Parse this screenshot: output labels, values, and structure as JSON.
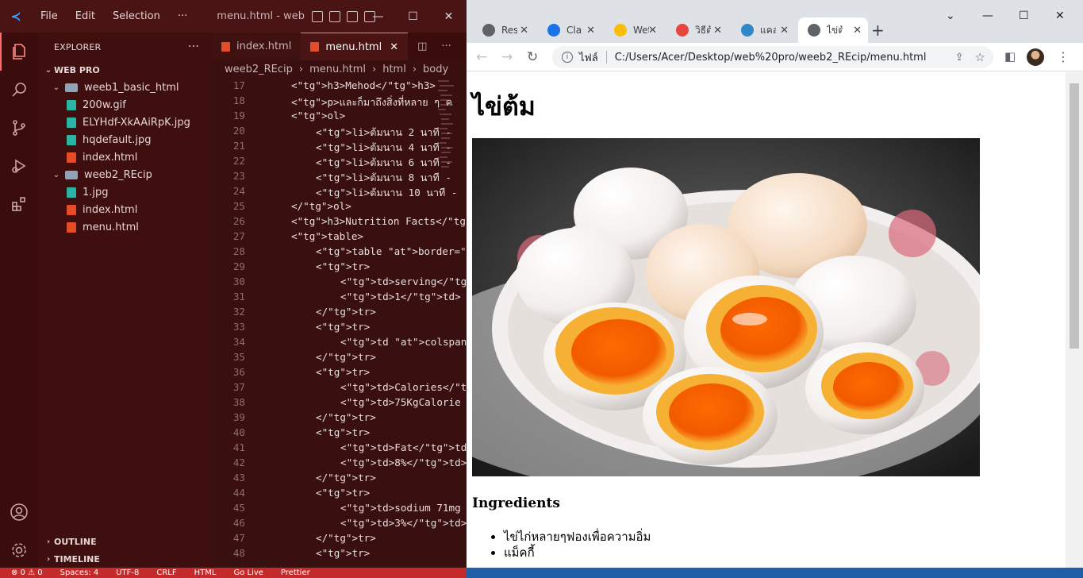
{
  "vscode": {
    "menu": [
      "File",
      "Edit",
      "Selection",
      "···"
    ],
    "window_title": "menu.html - web p...",
    "explorer_title": "EXPLORER",
    "workspace": "WEB PRO",
    "tree": [
      {
        "label": "weeb1_basic_html",
        "type": "folder",
        "depth": 1
      },
      {
        "label": "200w.gif",
        "type": "image",
        "depth": 2
      },
      {
        "label": "ELYHdf-XkAAiRpK.jpg",
        "type": "image",
        "depth": 2
      },
      {
        "label": "hqdefault.jpg",
        "type": "image",
        "depth": 2
      },
      {
        "label": "index.html",
        "type": "html",
        "depth": 2
      },
      {
        "label": "weeb2_REcip",
        "type": "folder",
        "depth": 1
      },
      {
        "label": "1.jpg",
        "type": "image",
        "depth": 2
      },
      {
        "label": "index.html",
        "type": "html",
        "depth": 2
      },
      {
        "label": "menu.html",
        "type": "html",
        "depth": 2
      }
    ],
    "outline": "OUTLINE",
    "timeline": "TIMELINE",
    "tabs": [
      {
        "label": "index.html"
      },
      {
        "label": "menu.html"
      }
    ],
    "breadcrumb": [
      "weeb2_REcip",
      "menu.html",
      "html",
      "body"
    ],
    "code": [
      {
        "n": "17",
        "i": 0,
        "t": "<h3>Mehod</h3>"
      },
      {
        "n": "18",
        "i": 0,
        "t": "<p>และก็มาถึงสิ่งที่หลาย ๆ ค"
      },
      {
        "n": "19",
        "i": 0,
        "t": "<ol>"
      },
      {
        "n": "20",
        "i": 1,
        "t": "<li>ต้มนาน 2 นาที -"
      },
      {
        "n": "21",
        "i": 1,
        "t": "<li>ต้มนาน 4 นาที -"
      },
      {
        "n": "22",
        "i": 1,
        "t": "<li>ต้มนาน 6 นาที -"
      },
      {
        "n": "23",
        "i": 1,
        "t": "<li>ต้มนาน 8 นาที -"
      },
      {
        "n": "24",
        "i": 1,
        "t": "<li>ต้มนาน 10 นาที -"
      },
      {
        "n": "25",
        "i": 0,
        "t": "</ol>"
      },
      {
        "n": "26",
        "i": 0,
        "t": "<h3>Nutrition Facts</h3"
      },
      {
        "n": "27",
        "i": 0,
        "t": "<table>"
      },
      {
        "n": "28",
        "i": 1,
        "t": "<table border=\"1\">"
      },
      {
        "n": "29",
        "i": 1,
        "t": "<tr>"
      },
      {
        "n": "30",
        "i": 2,
        "t": "<td>serving</td"
      },
      {
        "n": "31",
        "i": 2,
        "t": "<td>1</td>"
      },
      {
        "n": "32",
        "i": 1,
        "t": "</tr>"
      },
      {
        "n": "33",
        "i": 1,
        "t": "<tr>"
      },
      {
        "n": "34",
        "i": 2,
        "t": "<td colspan=\"2\""
      },
      {
        "n": "35",
        "i": 1,
        "t": "</tr>"
      },
      {
        "n": "36",
        "i": 1,
        "t": "<tr>"
      },
      {
        "n": "37",
        "i": 2,
        "t": "<td>Calories</t"
      },
      {
        "n": "38",
        "i": 2,
        "t": "<td>75KgCalorie"
      },
      {
        "n": "39",
        "i": 1,
        "t": "</tr>"
      },
      {
        "n": "40",
        "i": 1,
        "t": "<tr>"
      },
      {
        "n": "41",
        "i": 2,
        "t": "<td>Fat</td>"
      },
      {
        "n": "42",
        "i": 2,
        "t": "<td>8%</td>"
      },
      {
        "n": "43",
        "i": 1,
        "t": "</tr>"
      },
      {
        "n": "44",
        "i": 1,
        "t": "<tr>"
      },
      {
        "n": "45",
        "i": 2,
        "t": "<td>sodium 71mg"
      },
      {
        "n": "46",
        "i": 2,
        "t": "<td>3%</td>"
      },
      {
        "n": "47",
        "i": 1,
        "t": "</tr>"
      },
      {
        "n": "48",
        "i": 1,
        "t": "<tr>"
      }
    ],
    "status": [
      "⊗ 0 ⚠ 0",
      "Spaces: 4",
      "UTF-8",
      "CRLF",
      "HTML",
      "Go Live",
      "Prettier"
    ]
  },
  "chrome": {
    "tabs": [
      {
        "title": "Res",
        "color": "#5f6368"
      },
      {
        "title": "Clas",
        "color": "#1a73e8"
      },
      {
        "title": "Wet",
        "color": "#fbbc04"
      },
      {
        "title": "วิธีต้มไข่",
        "color": "#e8453c"
      },
      {
        "title": "แคลอรี่ไข่",
        "color": "#2e88c9"
      },
      {
        "title": "ไข่ต้ม",
        "color": "#5f6368"
      }
    ],
    "url_scheme": "ไฟล์",
    "url": "C:/Users/Acer/Desktop/web%20pro/weeb2_REcip/menu.html"
  },
  "page": {
    "title": "ไข่ต้ม",
    "section": "Ingredients",
    "items": [
      "ไข่ไก่หลายๆฟองเพื่อความอิ่ม",
      "แม็คกี้"
    ]
  }
}
